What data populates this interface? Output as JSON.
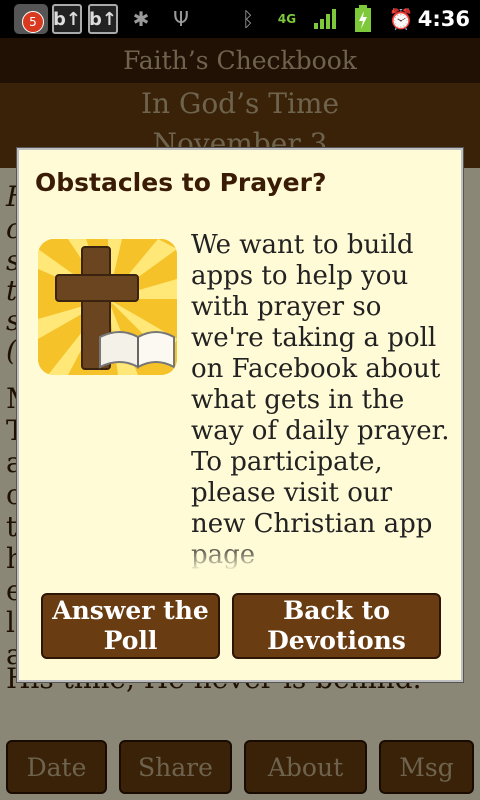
{
  "status_bar": {
    "notification_count": "5",
    "time": "4:36",
    "icons": [
      "app-notification-icon",
      "b-upload-icon",
      "b-upload-icon",
      "android-debug-icon",
      "usb-icon",
      "bluetooth-icon",
      "4g-icon",
      "signal-icon",
      "battery-charging-icon",
      "alarm-icon"
    ]
  },
  "app": {
    "title": "Faith’s Checkbook",
    "subtitle": "In God’s Time",
    "date_partial": "November 3",
    "body_fragments": [
      "F",
      "c",
      "s",
      "t",
      "s",
      "(",
      "M",
      "T",
      "a",
      "c",
      "t",
      "h",
      "e",
      "l",
      "a",
      "His time, He never is behind."
    ],
    "bottom_tabs": [
      "Date",
      "Share",
      "About",
      "Msg"
    ]
  },
  "dialog": {
    "title": "Obstacles to Prayer?",
    "image_icon": "cross-bible-icon",
    "message": "We want to build apps to help you with prayer so we're taking a poll on Facebook about what gets in the way of daily prayer. To participate, please visit our new Christian app page",
    "buttons": {
      "poll": "Answer the Poll",
      "back": "Back to Devotions"
    }
  },
  "colors": {
    "brown_dark": "#3d1f0a",
    "brown": "#6a3f12",
    "parchment": "#fffbd6",
    "gold_text": "#c9b48c",
    "badge_red": "#d93a1f"
  }
}
